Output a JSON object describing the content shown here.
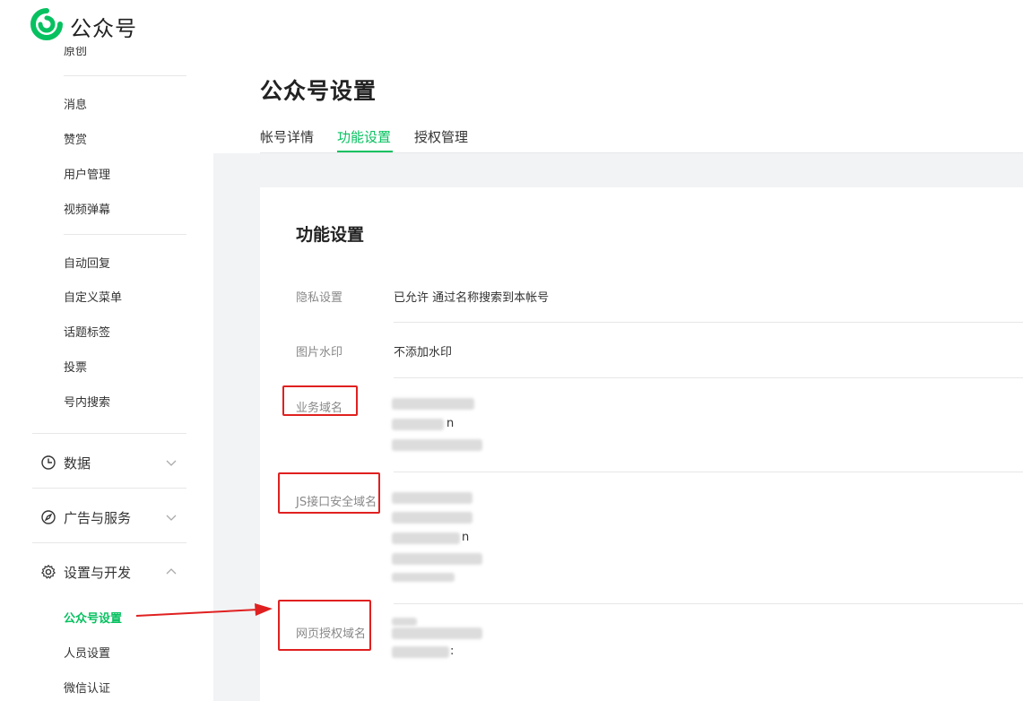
{
  "brand": {
    "name": "公众号"
  },
  "sidebar": {
    "top_partial": "原创",
    "items_group1": [
      "消息",
      "赞赏",
      "用户管理",
      "视频弹幕"
    ],
    "items_group2": [
      "自动回复",
      "自定义菜单",
      "话题标签",
      "投票",
      "号内搜索"
    ],
    "groups": [
      {
        "label": "数据",
        "icon": "clock-icon",
        "expanded": false
      },
      {
        "label": "广告与服务",
        "icon": "compass-icon",
        "expanded": false
      },
      {
        "label": "设置与开发",
        "icon": "gear-icon",
        "expanded": true
      }
    ],
    "sub_items": [
      "公众号设置",
      "人员设置",
      "微信认证"
    ],
    "active_item": "公众号设置"
  },
  "page": {
    "title": "公众号设置",
    "tabs": [
      {
        "label": "帐号详情",
        "active": false
      },
      {
        "label": "功能设置",
        "active": true
      },
      {
        "label": "授权管理",
        "active": false
      }
    ]
  },
  "panel": {
    "title": "功能设置",
    "rows": [
      {
        "label": "隐私设置",
        "value": "已允许 通过名称搜索到本帐号"
      },
      {
        "label": "图片水印",
        "value": "不添加水印"
      },
      {
        "label": "业务域名",
        "value_fragments": [
          "n"
        ]
      },
      {
        "label": "JS接口安全域名",
        "value_fragments": [
          "n"
        ]
      },
      {
        "label": "网页授权域名",
        "value_fragments": [
          ":"
        ]
      }
    ]
  },
  "colors": {
    "accent": "#07c160",
    "highlight": "#e02020"
  }
}
